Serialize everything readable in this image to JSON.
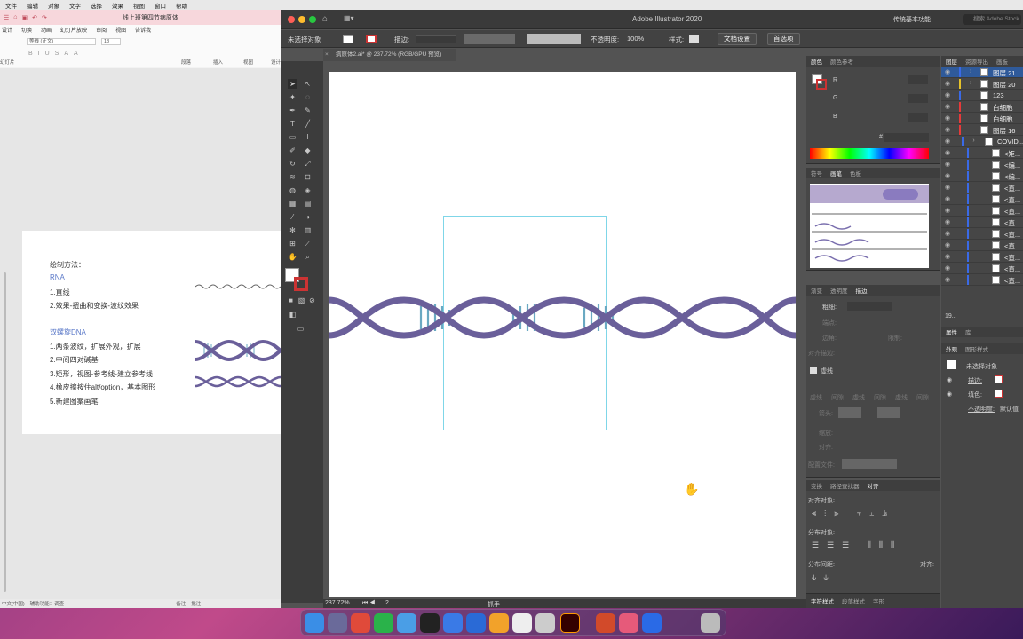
{
  "menubar": {
    "items": [
      "文件",
      "编辑",
      "对象",
      "文字",
      "选择",
      "效果",
      "视图",
      "窗口",
      "帮助"
    ]
  },
  "wps": {
    "title": "线上班第四节病原体",
    "tabs": [
      "设计",
      "切换",
      "动画",
      "幻灯片放映",
      "审阅",
      "视图",
      "告诉我"
    ],
    "ribbon": {
      "font": "等线 (正文)",
      "size": "18",
      "paste_label": "幻灯片",
      "paragraph_label": "段落",
      "insert_label": "插入",
      "view_label": "视图",
      "design_label": "设计"
    },
    "slide": {
      "heading": "绘制方法：",
      "rna_title": "RNA",
      "rna_steps": [
        "1.直线",
        "2.效果-扭曲和变换-波纹效果"
      ],
      "dna_title": "双螺旋DNA",
      "dna_steps": [
        "1.两条波纹，扩展外观，扩展",
        "2.中间四对碱基",
        "3.矩形，视图-参考线-建立参考线",
        "4.橡皮擦按住alt/option，基本图形",
        "5.新建图案画笔"
      ]
    },
    "status": {
      "lang": "中文(中国)",
      "accessibility": "辅助功能：调查",
      "notes": "备注",
      "comments": "批注"
    }
  },
  "ai": {
    "app_title": "Adobe Illustrator 2020",
    "workspace": "传统基本功能",
    "search_placeholder": "搜索 Adobe Stock",
    "control": {
      "no_selection": "未选择对象",
      "stroke_label": "描边:",
      "opacity_label": "不透明度:",
      "opacity": "100%",
      "style_label": "样式:",
      "doc_setup": "文档设置",
      "preferences": "首选项"
    },
    "doc_tab": "病原体2.ai* @ 237.72% (RGB/GPU 预览)",
    "status": {
      "zoom": "237.72%",
      "page": "2",
      "tool": "抓手"
    },
    "color_panel": {
      "tabs": [
        "颜色",
        "颜色参考"
      ],
      "r": "R",
      "g": "G",
      "b": "B",
      "hex_label": "#"
    },
    "brush_panel": {
      "tabs": [
        "符号",
        "画笔",
        "色板"
      ]
    },
    "stroke_panel": {
      "tabs": [
        "渐变",
        "透明度",
        "描边"
      ],
      "weight_label": "粗细:",
      "cap_label": "端点:",
      "corner_label": "边角:",
      "limit_label": "限制:",
      "align_label": "对齐描边:",
      "dashed_label": "虚线",
      "dash_labels": [
        "虚线",
        "间隙",
        "虚线",
        "间隙",
        "虚线",
        "间隙"
      ],
      "arrow_label": "箭头:",
      "scale_label": "缩放:",
      "align2_label": "对齐:",
      "profile_label": "配置文件:"
    },
    "align_panel": {
      "tabs": [
        "变换",
        "路径查找器",
        "对齐"
      ],
      "align_objects": "对齐对象:",
      "distribute_objects": "分布对象:",
      "distribute_spacing": "分布间距:",
      "align_to": "对齐:"
    },
    "char_panel": {
      "tabs": [
        "字符样式",
        "段落样式",
        "字形"
      ]
    },
    "layers_panel": {
      "tabs": [
        "图层",
        "资源导出",
        "画板"
      ],
      "rows": [
        "图层 21",
        "图层 20",
        "123",
        "白细胞",
        "白细胞",
        "图层 16",
        "COVID...",
        "<矩...",
        "<编...",
        "<编...",
        "<直...",
        "<直...",
        "<直...",
        "<直...",
        "<直...",
        "<直...",
        "<直...",
        "<直...",
        "<直..."
      ],
      "count": "19..."
    },
    "appearance_panel": {
      "tabs": [
        "属性",
        "库"
      ],
      "sub_tabs": [
        "外观",
        "图形样式"
      ],
      "no_selection": "未选择对象",
      "stroke": "描边:",
      "fill": "填色:",
      "opacity": "不透明度:",
      "opacity_value": "默认值"
    }
  },
  "colors": {
    "dna_strand": "#6a5f9a",
    "dna_base": "#6aa9c2",
    "guide": "#7fd6e8"
  }
}
